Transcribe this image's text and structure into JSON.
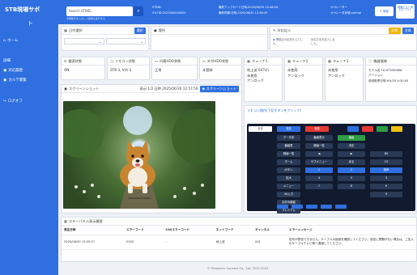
{
  "app": {
    "brand_line1": "STB現場サポ",
    "brand_line2": "ト"
  },
  "sidebar": {
    "items": [
      {
        "label": "ホーム",
        "icon": "home-icon"
      },
      {
        "label": "詳細",
        "icon": "list-icon"
      },
      {
        "label": "対応履歴",
        "icon": "history-icon"
      },
      {
        "label": "カルテ閲覧",
        "icon": "chart-icon"
      },
      {
        "label": "ログオフ",
        "icon": "logout-icon"
      }
    ]
  },
  "header": {
    "search_placeholder": "Search STBID...",
    "search_hint": "半角数字を入力して検索を実行する",
    "stbid_label": "STBID:",
    "stbid_value": "5%7ID:2023000000002",
    "last_updated": "最終アップロード日時:2025/06/30 12:48:16",
    "last_synced": "最終同期:日時:2025/06/30 12:48:29",
    "opmode_label": "オペレーター",
    "opmode_value": "オペレータ状態:normal",
    "update_btn": "更新",
    "user_btn": "現場テスト用 ログアウト"
  },
  "filters": {
    "date_label": "日付選択",
    "date_button": "選択",
    "location_label": "場所",
    "remark_label": "対応記入",
    "status_yellow": "状態",
    "status_blue": "全体",
    "remark_line1": "問題点の記述を入力し",
    "remark_line2": "た。",
    "remark_line3": "対応方法を記入しま",
    "remark_line4": "した。"
  },
  "cards": [
    {
      "title": "電源状態",
      "value": "ON",
      "icon": "power-icon"
    },
    {
      "title": "リモコン状態",
      "value": "STB 3, Virt 3",
      "icon": "remote-icon"
    },
    {
      "title": "内蔵HDD状態",
      "value": "正常",
      "icon": "hdd-icon"
    },
    {
      "title": "外付HDD状態",
      "value": "未登録",
      "icon": "ext-hdd-icon"
    },
    {
      "title": "チューナ1",
      "value": "地上波 047ch",
      "sub1": "未使用",
      "sub2": "アンロック",
      "icon": "tuner-icon"
    },
    {
      "title": "チューナ2",
      "value": "未使用",
      "sub1": "アンロック",
      "sub2": "",
      "icon": "tuner-icon"
    },
    {
      "title": "チューナ3",
      "value": "未使用",
      "sub1": "アンロック",
      "sub2": "",
      "icon": "tuner-icon"
    },
    {
      "title": "機器情報",
      "value": "モデル名:TZ-HT3500BW",
      "sub1": "バージョン",
      "sub2": "前回取得日時:9/4/25 4:30:00",
      "icon": "info-icon"
    }
  ],
  "screenshot": {
    "title": "スクリーンショット",
    "timestamp": "表示:1/2 日時:2025/06/30 12:57:56",
    "refresh_btn": "スクリーンショット"
  },
  "remote": {
    "title": "リモコン操作(下記ボタンをクリック)",
    "top_label1": "戻る",
    "top_label2": "放送",
    "top_label3": "電源",
    "left_buttons": [
      "データ多",
      "番組表",
      "録画一覧",
      "ホーム",
      "ボタン",
      "拡大",
      "メニュー",
      "4K入力",
      "お好み機能",
      "プレミアム"
    ],
    "mid_buttons": [
      "番組表示",
      "録画一覧",
      "◀",
      "サブメニュー",
      "1",
      "4",
      "7"
    ],
    "right_buttons": [
      "番組",
      "決定",
      "▶",
      "戻る",
      "2",
      "5",
      "8"
    ],
    "far_buttons": [
      "BS",
      "CS",
      "音声",
      "3",
      "6",
      "9"
    ]
  },
  "error_history": {
    "title": "エラーパネル表示履歴",
    "columns": [
      "発生日時",
      "エラーコード",
      "CASエラーコード",
      "ネットワーク",
      "チャンネル",
      "エラーメッセージ"
    ],
    "rows": [
      {
        "datetime": "2025/06/30 12:05:57",
        "code": "E202",
        "cas": "-",
        "network": "地上波",
        "channel": "041",
        "message": "信号が受信できません。ケーブルの接続を確認してください。設定に問題がない場合は、ご加入のケーブルテレビ等へ連絡してください。"
      }
    ]
  },
  "footer": {
    "copyright": "© Panasonic Connect Co., Ltd. 2024-2025"
  }
}
